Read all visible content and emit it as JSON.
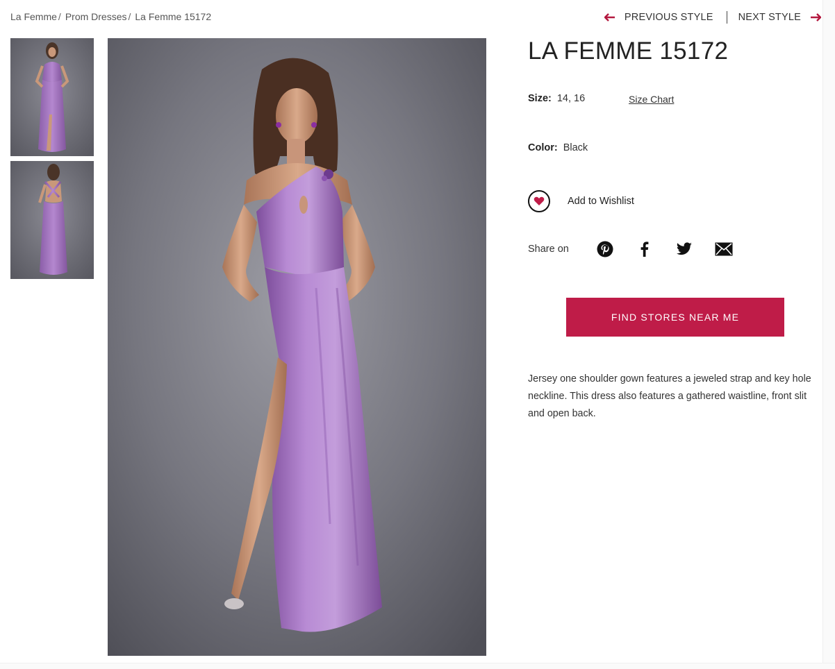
{
  "breadcrumb": {
    "items": [
      {
        "label": "La Femme",
        "sep": "/"
      },
      {
        "label": "Prom Dresses",
        "sep": "/"
      },
      {
        "label": "La Femme 15172",
        "sep": ""
      }
    ]
  },
  "style_nav": {
    "previous_label": "PREVIOUS STYLE",
    "next_label": "NEXT STYLE",
    "arrow_color": "#b3183f"
  },
  "product": {
    "title": "LA FEMME 15172",
    "size_label": "Size:",
    "size_value": "14, 16",
    "size_chart_link": "Size Chart",
    "color_label": "Color:",
    "color_value": "Black",
    "wishlist_label": "Add to Wishlist",
    "share_label": "Share on",
    "share_icons": [
      "pinterest-icon",
      "facebook-icon",
      "twitter-icon",
      "email-icon"
    ],
    "find_stores_label": "FIND STORES NEAR ME",
    "description": "Jersey one shoulder gown features a jeweled strap and key hole neckline. This dress also features a gathered waistline, front slit and open back."
  },
  "colors": {
    "accent": "#bf1c48",
    "dress": "#a877c6",
    "backdrop": "#6e6e78"
  }
}
